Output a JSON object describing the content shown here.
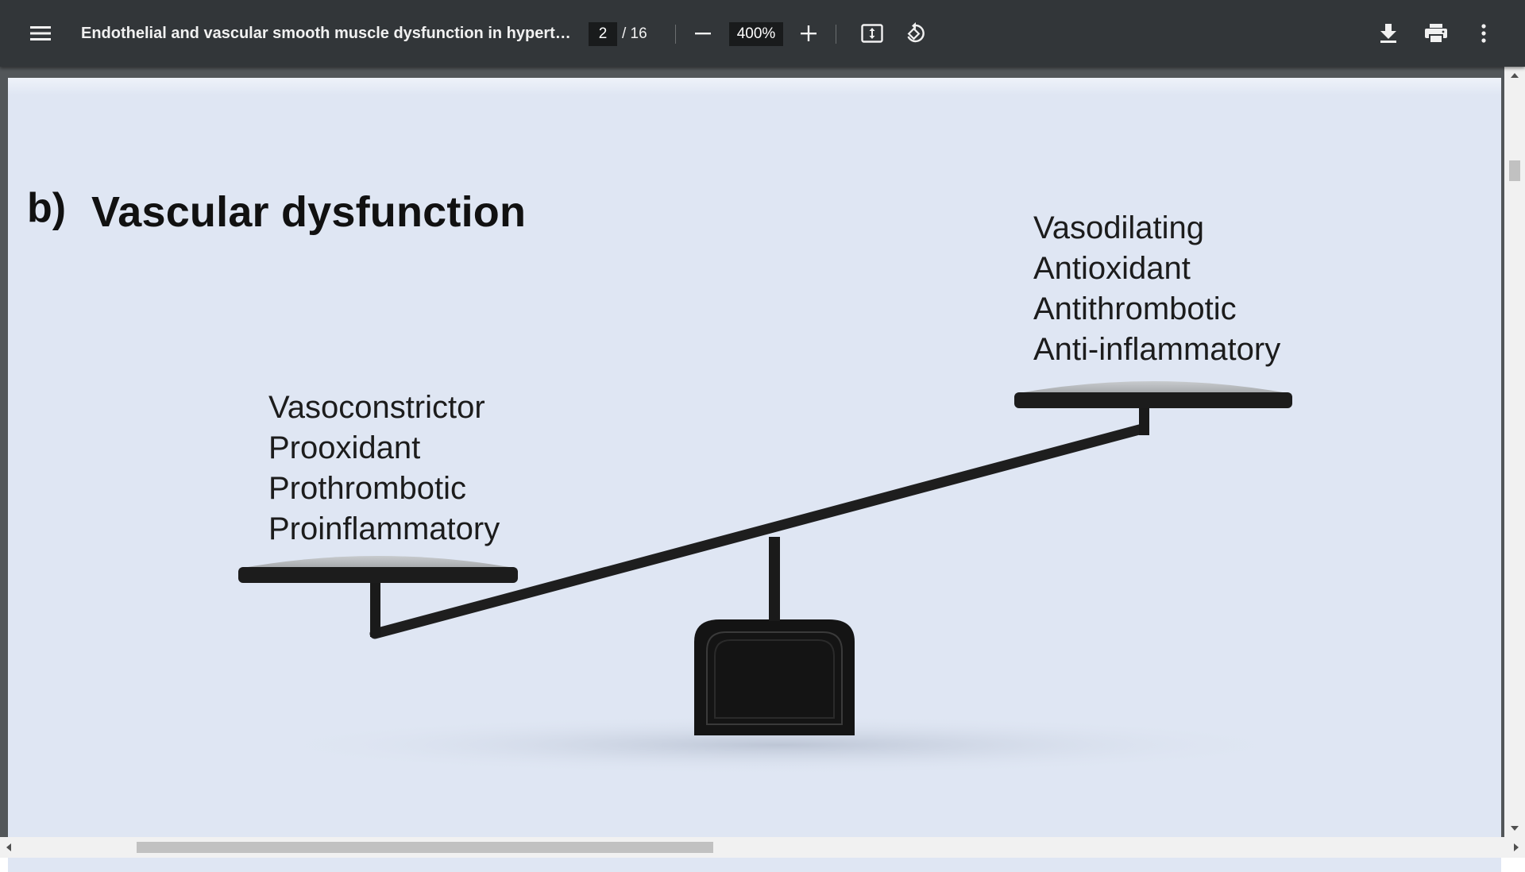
{
  "toolbar": {
    "menu_icon": "hamburger-menu-icon",
    "title": "Endothelial and vascular smooth muscle dysfunction in hyperte...",
    "current_page": "2",
    "page_total": "/ 16",
    "zoom_out_icon": "minus-icon",
    "zoom_value": "400%",
    "zoom_in_icon": "plus-icon",
    "fit_icon": "fit-to-page-icon",
    "rotate_icon": "rotate-counterclockwise-icon",
    "download_icon": "download-icon",
    "print_icon": "print-icon",
    "more_icon": "more-vertical-icon"
  },
  "document": {
    "figure_letter": "b)",
    "figure_title": "Vascular dysfunction",
    "left_pan_terms": [
      "Vasoconstrictor",
      "Prooxidant",
      "Prothrombotic",
      "Proinflammatory"
    ],
    "right_pan_terms": [
      "Vasodilating",
      "Antioxidant",
      "Antithrombotic",
      "Anti-inflammatory"
    ]
  },
  "colors": {
    "toolbar_bg": "#323639",
    "page_bg": "#dfe6f3",
    "seesaw": "#1c1c1c",
    "pan_top": "#a7aaad"
  }
}
